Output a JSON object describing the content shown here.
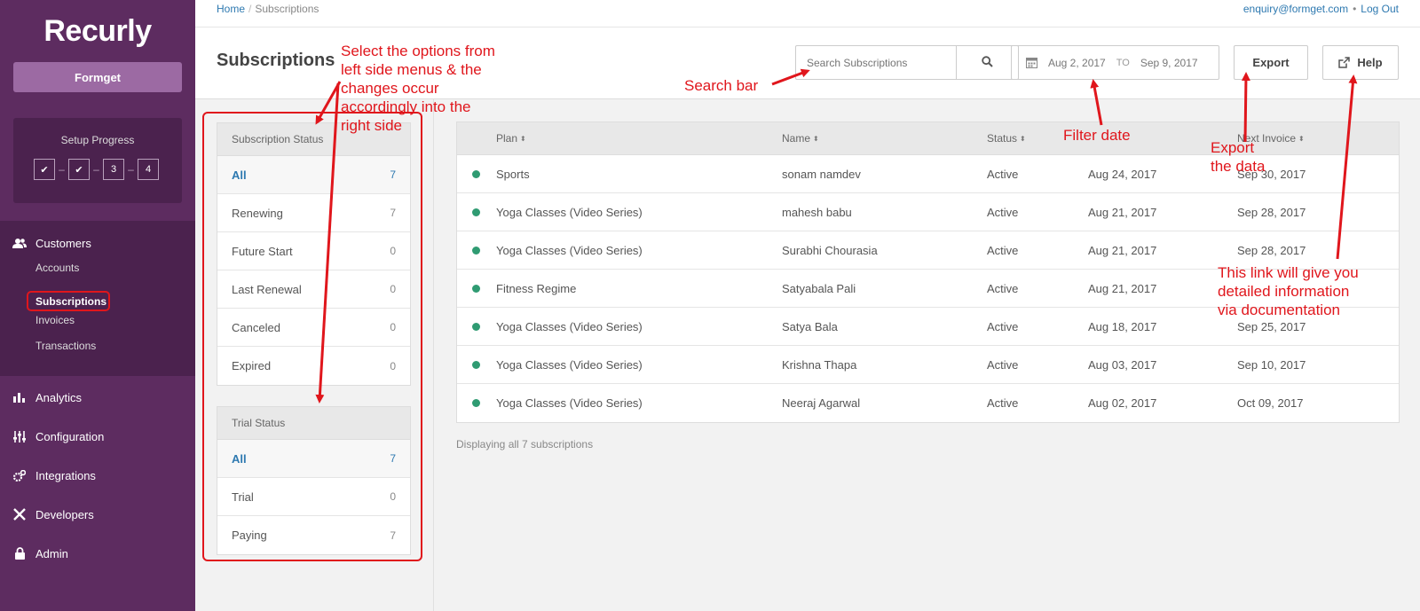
{
  "sidebar": {
    "logo": "Recurly",
    "account": "Formget",
    "setup": {
      "title": "Setup Progress",
      "steps": [
        "✔",
        "✔",
        "3",
        "4"
      ]
    },
    "sections": [
      {
        "label": "Customers",
        "icon": "users-icon"
      },
      {
        "label": "Analytics",
        "icon": "bar-chart-icon"
      },
      {
        "label": "Configuration",
        "icon": "sliders-icon"
      },
      {
        "label": "Integrations",
        "icon": "cogs-icon"
      },
      {
        "label": "Developers",
        "icon": "tools-icon"
      },
      {
        "label": "Admin",
        "icon": "lock-icon"
      }
    ],
    "customers_sub": [
      "Accounts",
      "Subscriptions",
      "Invoices",
      "Transactions"
    ]
  },
  "topbar": {
    "breadcrumb_home": "Home",
    "breadcrumb_separator": "/",
    "breadcrumb_current": "Subscriptions",
    "email": "enquiry@formget.com",
    "separator": "•",
    "logout": "Log Out"
  },
  "header": {
    "title": "Subscriptions",
    "search_placeholder": "Search Subscriptions",
    "date_from": "Aug 2, 2017",
    "date_to_label": "TO",
    "date_to": "Sep 9, 2017",
    "export": "Export",
    "help": "Help"
  },
  "subscription_status": {
    "title": "Subscription Status",
    "items": [
      {
        "label": "All",
        "count": "7"
      },
      {
        "label": "Renewing",
        "count": "7"
      },
      {
        "label": "Future Start",
        "count": "0"
      },
      {
        "label": "Last Renewal",
        "count": "0"
      },
      {
        "label": "Canceled",
        "count": "0"
      },
      {
        "label": "Expired",
        "count": "0"
      }
    ]
  },
  "trial_status": {
    "title": "Trial Status",
    "items": [
      {
        "label": "All",
        "count": "7"
      },
      {
        "label": "Trial",
        "count": "0"
      },
      {
        "label": "Paying",
        "count": "7"
      }
    ]
  },
  "table": {
    "columns": [
      "Plan",
      "Name",
      "Status",
      "Next Invoice"
    ],
    "sort_glyph": "⬍",
    "rows": [
      {
        "plan": "Sports",
        "name": "sonam namdev",
        "status": "Active",
        "date1": "Aug 24, 2017",
        "date2": "Sep 30, 2017"
      },
      {
        "plan": "Yoga Classes (Video Series)",
        "name": "mahesh babu",
        "status": "Active",
        "date1": "Aug 21, 2017",
        "date2": "Sep 28, 2017"
      },
      {
        "plan": "Yoga Classes (Video Series)",
        "name": "Surabhi Chourasia",
        "status": "Active",
        "date1": "Aug 21, 2017",
        "date2": "Sep 28, 2017"
      },
      {
        "plan": "Fitness Regime",
        "name": "Satyabala Pali",
        "status": "Active",
        "date1": "Aug 21, 2017",
        "date2": ""
      },
      {
        "plan": "Yoga Classes (Video Series)",
        "name": "Satya Bala",
        "status": "Active",
        "date1": "Aug 18, 2017",
        "date2": "Sep 25, 2017"
      },
      {
        "plan": "Yoga Classes (Video Series)",
        "name": "Krishna Thapa",
        "status": "Active",
        "date1": "Aug 03, 2017",
        "date2": "Sep 10, 2017"
      },
      {
        "plan": "Yoga Classes (Video Series)",
        "name": "Neeraj Agarwal",
        "status": "Active",
        "date1": "Aug 02, 2017",
        "date2": "Oct 09, 2017"
      }
    ],
    "footer": "Displaying all 7 subscriptions"
  },
  "annotations": {
    "filters": [
      "Select the options from",
      "left side menus & the",
      "changes occur",
      "accordingly into the",
      "right side"
    ],
    "search": "Search bar",
    "filter_date": "Filter date",
    "export": [
      "Export",
      "the data"
    ],
    "help": [
      "This link will give you",
      "detailed information",
      "via documentation"
    ]
  },
  "colors": {
    "sidebar": "#5d2c60",
    "sidebar_dark": "#4b224e",
    "link": "#2e79b0",
    "status_active": "#2f9b72",
    "annotation": "#e0161c"
  }
}
